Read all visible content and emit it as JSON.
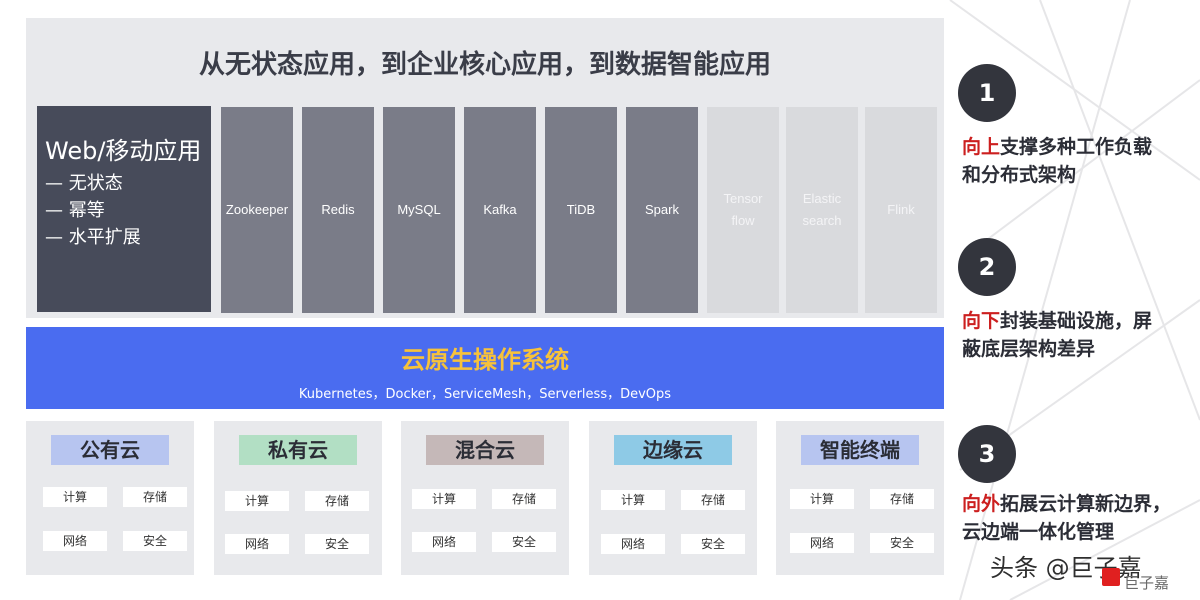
{
  "apps": {
    "title": "从无状态应用，到企业核心应用，到数据智能应用",
    "web": {
      "title": "Web/移动应用",
      "lines": [
        "— 无状态",
        "— 幂等",
        "— 水平扩展"
      ]
    },
    "columns": [
      {
        "line1": "Zookeeper",
        "line2": "",
        "style": "dark"
      },
      {
        "line1": "Redis",
        "line2": "",
        "style": "dark"
      },
      {
        "line1": "MySQL",
        "line2": "",
        "style": "dark"
      },
      {
        "line1": "Kafka",
        "line2": "",
        "style": "dark"
      },
      {
        "line1": "TiDB",
        "line2": "",
        "style": "dark"
      },
      {
        "line1": "Spark",
        "line2": "",
        "style": "dark"
      },
      {
        "line1": "Tensor",
        "line2": "flow",
        "style": "light"
      },
      {
        "line1": "Elastic",
        "line2": "search",
        "style": "light"
      },
      {
        "line1": "Flink",
        "line2": "",
        "style": "light"
      }
    ]
  },
  "os": {
    "title": "云原生操作系统",
    "subtitle": "Kubernetes，Docker，ServiceMesh，Serverless，DevOps"
  },
  "clouds": [
    {
      "label": "公有云",
      "color": "#b7c5f0",
      "cells": [
        "计算",
        "存储",
        "网络",
        "安全"
      ]
    },
    {
      "label": "私有云",
      "color": "#b2dfc4",
      "cells": [
        "计算",
        "存储",
        "网络",
        "安全"
      ]
    },
    {
      "label": "混合云",
      "color": "#c5b8b8",
      "cells": [
        "计算",
        "存储",
        "网络",
        "安全"
      ]
    },
    {
      "label": "边缘云",
      "color": "#8ecae6",
      "cells": [
        "计算",
        "存储",
        "网络",
        "安全"
      ]
    },
    {
      "label": "智能终端",
      "color": "#b7c5f0",
      "cells": [
        "计算",
        "存储",
        "网络",
        "安全"
      ]
    }
  ],
  "points": [
    {
      "num": "1",
      "highlight": "向上",
      "line1_rest": "支撑多种工作负载",
      "line2": "和分布式架构"
    },
    {
      "num": "2",
      "highlight": "向下",
      "line1_rest": "封装基础设施，屏",
      "line2": "蔽底层架构差异"
    },
    {
      "num": "3",
      "highlight": "向外",
      "line1_rest": "拓展云计算新边界，",
      "line2": "云边端一体化管理"
    }
  ],
  "watermark": {
    "text": "头条 @巨子嘉",
    "sub": "巨子嘉"
  },
  "colors": {
    "os_bar": "#4a6cf0",
    "os_title": "#f7c23a",
    "highlight": "#cc1f1f",
    "web_block": "#474b5a",
    "app_dark": "#7a7c88",
    "app_light": "#d9dadd"
  }
}
